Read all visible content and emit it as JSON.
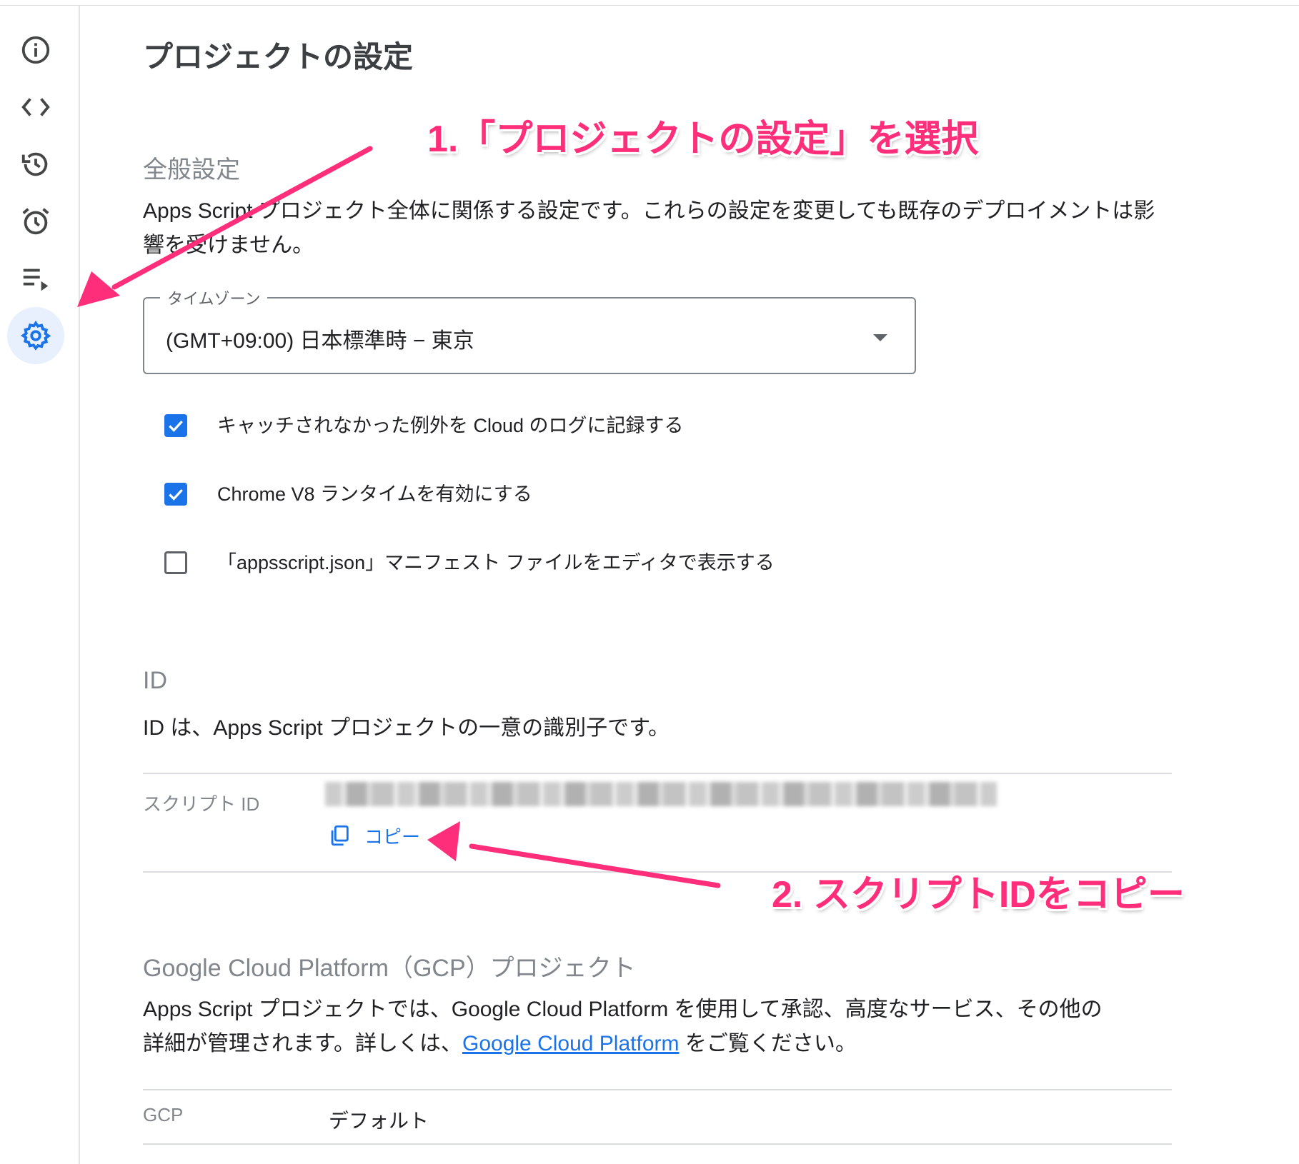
{
  "sidebar": {
    "items": [
      {
        "icon": "info-icon",
        "active": false
      },
      {
        "icon": "code-icon",
        "active": false
      },
      {
        "icon": "history-icon",
        "active": false
      },
      {
        "icon": "alarm-icon",
        "active": false
      },
      {
        "icon": "executions-icon",
        "active": false
      },
      {
        "icon": "gear-icon",
        "active": true
      }
    ]
  },
  "main": {
    "title": "プロジェクトの設定",
    "general": {
      "heading": "全般設定",
      "description": "Apps Script プロジェクト全体に関係する設定です。これらの設定を変更しても既存のデプロイメントは影響を受けません。",
      "timezone": {
        "label": "タイムゾーン",
        "value": "(GMT+09:00) 日本標準時 − 東京"
      },
      "checkboxes": [
        {
          "label": "キャッチされなかった例外を Cloud のログに記録する",
          "checked": true
        },
        {
          "label": "Chrome V8 ランタイムを有効にする",
          "checked": true
        },
        {
          "label": "「appsscript.json」マニフェスト ファイルをエディタで表示する",
          "checked": false
        }
      ]
    },
    "ids": {
      "heading": "ID",
      "description": "ID は、Apps Script プロジェクトの一意の識別子です。",
      "script_id_label": "スクリプト ID",
      "copy_label": "コピー"
    },
    "gcp": {
      "heading": "Google Cloud Platform（GCP）プロジェクト",
      "description_line1": "Apps Script プロジェクトでは、Google Cloud Platform を使用して承認、高度なサービス、その他の",
      "description_line2_before": "詳細が管理されます。詳しくは、",
      "link_text": "Google Cloud Platform",
      "description_line2_after": " をご覧ください。",
      "row_label": "GCP",
      "row_value": "デフォルト"
    }
  },
  "annotations": {
    "step1": "1.「プロジェクトの設定」を選択",
    "step2": "2. スクリプトIDをコピー",
    "color": "#ff2e7a"
  },
  "colors": {
    "accent": "#1a73e8",
    "active_bg": "#e8f0fe",
    "annotation": "#ff2e7a"
  }
}
